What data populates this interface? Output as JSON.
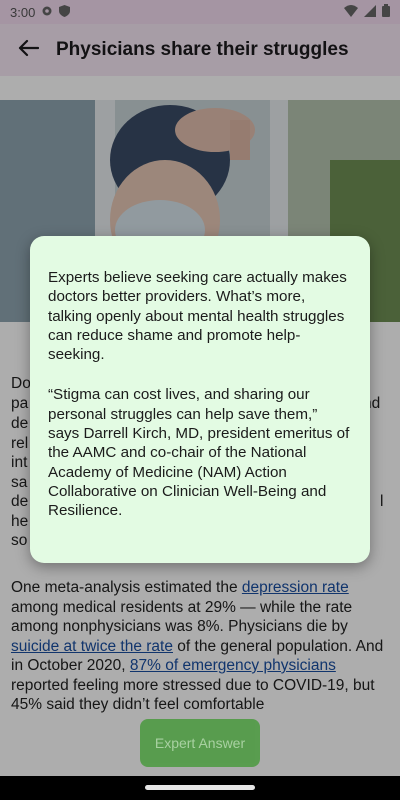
{
  "status_bar": {
    "time": "3:00"
  },
  "app_bar": {
    "title": "Physicians share their struggles"
  },
  "article": {
    "fragments": [
      "Do",
      "pa",
      "nd",
      "de",
      "rel",
      "int",
      "sa",
      "de",
      "l",
      "he",
      "so"
    ],
    "para2": {
      "t1": "One meta-analysis estimated the ",
      "l1": "depression rate",
      "t2": " among medical residents at 29% — while the rate among nonphysicians was 8%. Physicians die by ",
      "l2": "suicide at twice the rate",
      "t3": " of the general population. And in October 2020, ",
      "l3": "87% of emergency physicians",
      "t4": " reported feeling more stressed due to COVID-19, but 45% said they didn’t feel comfortable"
    }
  },
  "dialog": {
    "paragraph1": "Experts believe seeking care actually makes doctors better providers. What’s more, talking openly about mental health struggles can reduce shame and promote help-seeking.",
    "paragraph2": "“Stigma can cost lives, and sharing our personal struggles can help save them,” says Darrell Kirch, MD, president emeritus of the AAMC and co-chair of the National Academy of Medicine (NAM) Action Collaborative on Clinician Well-Being and Resilience."
  },
  "fab": {
    "label": "Expert Answer"
  }
}
